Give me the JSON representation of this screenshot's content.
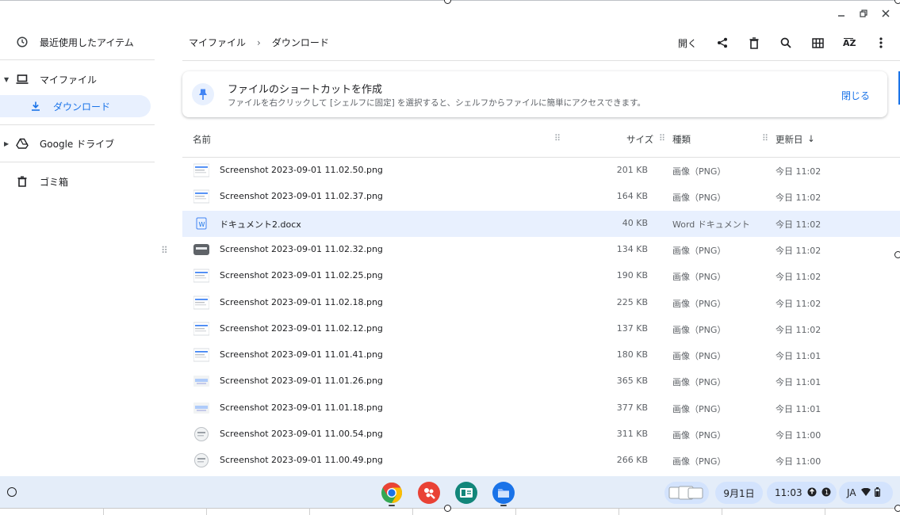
{
  "window": {
    "controls": [
      "minimize",
      "restore",
      "close"
    ]
  },
  "sidebar": {
    "items": [
      {
        "label": "最近使用したアイテム",
        "icon": "clock-icon"
      },
      {
        "label": "マイファイル",
        "icon": "laptop-icon"
      },
      {
        "label": "ダウンロード",
        "icon": "download-icon",
        "selected": true
      },
      {
        "label": "Google ドライブ",
        "icon": "drive-icon"
      },
      {
        "label": "ゴミ箱",
        "icon": "trash-icon"
      }
    ]
  },
  "breadcrumb": {
    "root": "マイファイル",
    "separator": "›",
    "current": "ダウンロード"
  },
  "toolbar": {
    "open_label": "開く",
    "icons": [
      "share-icon",
      "delete-icon",
      "search-icon",
      "grid-view-icon",
      "sort-az-icon",
      "more-vert-icon"
    ]
  },
  "banner": {
    "title": "ファイルのショートカットを作成",
    "subtitle": "ファイルを右クリックして [シェルフに固定] を選択すると、シェルフからファイルに簡単にアクセスできます。",
    "close_label": "閉じる"
  },
  "list": {
    "columns": {
      "name": "名前",
      "size": "サイズ",
      "type": "種類",
      "date": "更新日"
    },
    "sort_arrow": "↓",
    "rows": [
      {
        "name": "Screenshot 2023-09-01 11.02.50.png",
        "size": "201 KB",
        "type": "画像（PNG）",
        "date": "今日 11:02",
        "thumb": "doc"
      },
      {
        "name": "Screenshot 2023-09-01 11.02.37.png",
        "size": "164 KB",
        "type": "画像（PNG）",
        "date": "今日 11:02",
        "thumb": "doc"
      },
      {
        "name": "ドキュメント2.docx",
        "size": "40 KB",
        "type": "Word ドキュメント",
        "date": "今日 11:02",
        "thumb": "word",
        "selected": true
      },
      {
        "name": "Screenshot 2023-09-01 11.02.32.png",
        "size": "134 KB",
        "type": "画像（PNG）",
        "date": "今日 11:02",
        "thumb": "dark"
      },
      {
        "name": "Screenshot 2023-09-01 11.02.25.png",
        "size": "190 KB",
        "type": "画像（PNG）",
        "date": "今日 11:02",
        "thumb": "doc"
      },
      {
        "name": "Screenshot 2023-09-01 11.02.18.png",
        "size": "225 KB",
        "type": "画像（PNG）",
        "date": "今日 11:02",
        "thumb": "doc"
      },
      {
        "name": "Screenshot 2023-09-01 11.02.12.png",
        "size": "137 KB",
        "type": "画像（PNG）",
        "date": "今日 11:02",
        "thumb": "doc"
      },
      {
        "name": "Screenshot 2023-09-01 11.01.41.png",
        "size": "180 KB",
        "type": "画像（PNG）",
        "date": "今日 11:01",
        "thumb": "doc"
      },
      {
        "name": "Screenshot 2023-09-01 11.01.26.png",
        "size": "365 KB",
        "type": "画像（PNG）",
        "date": "今日 11:01",
        "thumb": "purple"
      },
      {
        "name": "Screenshot 2023-09-01 11.01.18.png",
        "size": "377 KB",
        "type": "画像（PNG）",
        "date": "今日 11:01",
        "thumb": "purple"
      },
      {
        "name": "Screenshot 2023-09-01 11.00.54.png",
        "size": "311 KB",
        "type": "画像（PNG）",
        "date": "今日 11:00",
        "thumb": "round"
      },
      {
        "name": "Screenshot 2023-09-01 11.00.49.png",
        "size": "266 KB",
        "type": "画像（PNG）",
        "date": "今日 11:00",
        "thumb": "round"
      }
    ]
  },
  "shelf": {
    "apps": [
      "chrome-icon",
      "paint-icon",
      "classroom-icon",
      "files-icon"
    ],
    "date": "9月1日",
    "time": "11:03",
    "ime": "JA",
    "colors": {
      "chrome_red": "#ea4335",
      "paint_red": "#e94235",
      "classroom_teal": "#12867a",
      "files_blue": "#1a73e8"
    }
  }
}
